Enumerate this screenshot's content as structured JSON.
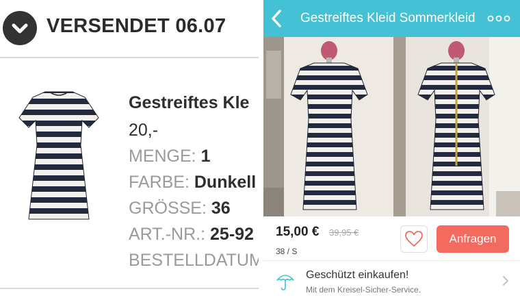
{
  "order": {
    "status": "VERSENDET 06.07",
    "product_title": "Gestreiftes Kle",
    "price": "20,-",
    "quantity_label": "MENGE:",
    "quantity_value": "1",
    "color_label": "FARBE:",
    "color_value": "Dunkell",
    "size_label": "GRÖSSE:",
    "size_value": "36",
    "artnr_label": "ART.-NR.:",
    "artnr_value": "25-92",
    "orderdate_label": "BESTELLDATUM"
  },
  "listing": {
    "title": "Gestreiftes Kleid Sommerkleid",
    "price": "15,00 €",
    "original_price": "39,95 €",
    "size": "38 / S",
    "ask_button": "Anfragen",
    "protected_title": "Geschützt einkaufen!",
    "protected_subtitle": "Mit dem Kreisel-Sicher-Service."
  },
  "colors": {
    "nav_bar": "#44c1d4",
    "ask_button": "#f36a5e",
    "stripe_dark": "#232a3d",
    "stripe_light": "#f4f1ea"
  },
  "icons": {
    "status": "chevron-down-icon",
    "back": "back-arrow-icon",
    "more": "more-dots-icon",
    "favorite": "heart-icon",
    "protection": "umbrella-icon",
    "disclosure": "chevron-right-icon"
  }
}
